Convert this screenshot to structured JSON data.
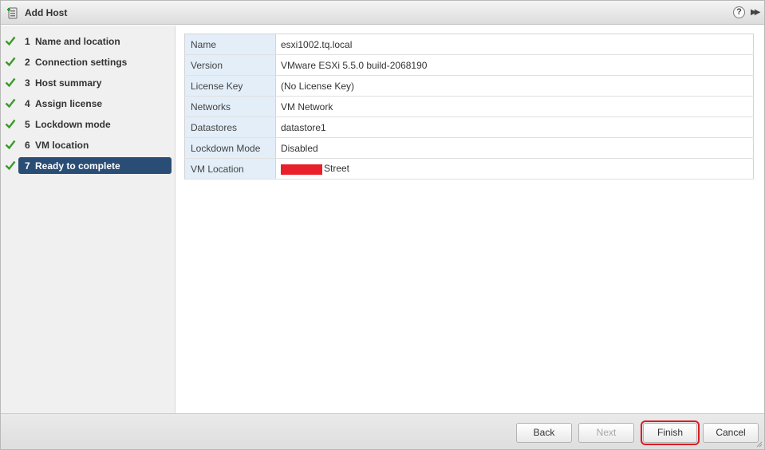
{
  "dialog": {
    "title": "Add Host"
  },
  "steps": [
    {
      "num": "1",
      "label": "Name and location",
      "done": true
    },
    {
      "num": "2",
      "label": "Connection settings",
      "done": true
    },
    {
      "num": "3",
      "label": "Host summary",
      "done": true
    },
    {
      "num": "4",
      "label": "Assign license",
      "done": true
    },
    {
      "num": "5",
      "label": "Lockdown mode",
      "done": true
    },
    {
      "num": "6",
      "label": "VM location",
      "done": true
    },
    {
      "num": "7",
      "label": "Ready to complete",
      "done": true,
      "active": true
    }
  ],
  "summary": [
    {
      "key": "Name",
      "value": "esxi1002.tq.local"
    },
    {
      "key": "Version",
      "value": "VMware ESXi 5.5.0 build-2068190"
    },
    {
      "key": "License Key",
      "value": "(No License Key)"
    },
    {
      "key": "Networks",
      "value": "VM Network"
    },
    {
      "key": "Datastores",
      "value": "datastore1"
    },
    {
      "key": "Lockdown Mode",
      "value": "Disabled"
    },
    {
      "key": "VM Location",
      "value": "Street"
    }
  ],
  "buttons": {
    "back": "Back",
    "next": "Next",
    "finish": "Finish",
    "cancel": "Cancel"
  },
  "icons": {
    "help": "?",
    "check_color": "#3a9a2a",
    "active_step_color": "#2a4d75",
    "redaction_color": "#e8202a",
    "highlight_color": "#d81f26"
  }
}
